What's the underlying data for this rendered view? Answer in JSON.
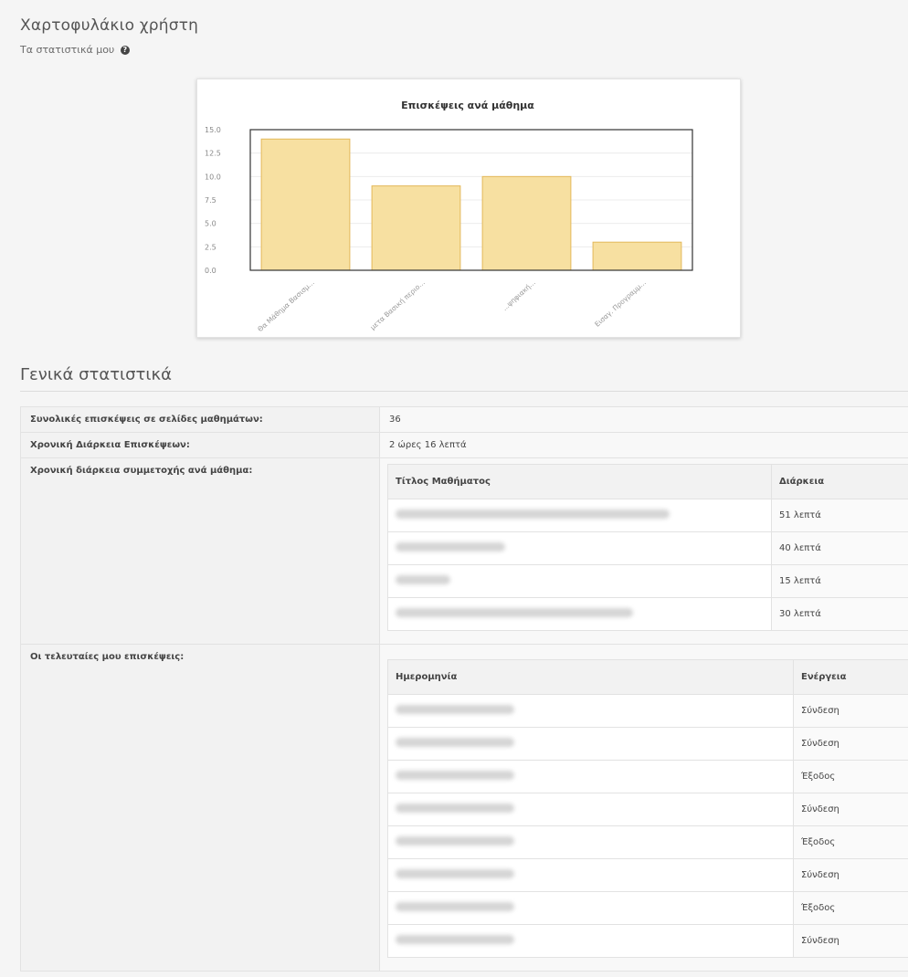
{
  "header": {
    "title": "Χαρτοφυλάκιο χρήστη",
    "subtitle": "Τα στατιστικά μου",
    "help_icon": "question-circle-icon"
  },
  "chart_data": {
    "type": "bar",
    "title": "Επισκέψεις ανά μάθημα",
    "xlabel": "",
    "ylabel": "",
    "categories": [
      "Θα Μάθημα Βασισμ...",
      "μετα Βασική περιο...",
      "...ψηφιακή...",
      "Εισαγ. Προγραμμ..."
    ],
    "values": [
      14,
      9,
      10,
      3
    ],
    "ylim": [
      0,
      15
    ],
    "yticks": [
      "15.0",
      "12.5",
      "10.0",
      "7.5",
      "5.0",
      "2.5",
      "0.0"
    ],
    "bar_color": "#f7e0a1",
    "bar_stroke": "#e3b85a",
    "grid": true
  },
  "general_stats": {
    "title": "Γενικά στατιστικά",
    "rows": [
      {
        "label": "Συνολικές επισκέψεις σε σελίδες μαθημάτων:",
        "value": "36"
      },
      {
        "label": "Χρονική Διάρκεια Επισκέψεων:",
        "value": "2 ώρες 16 λεπτά"
      }
    ],
    "course_duration": {
      "label": "Χρονική διάρκεια συμμετοχής ανά μάθημα:",
      "headers": [
        "Τίτλος Μαθήματος",
        "Διάρκεια"
      ],
      "rows": [
        {
          "duration": "51 λεπτά"
        },
        {
          "duration": "40 λεπτά"
        },
        {
          "duration": "15 λεπτά"
        },
        {
          "duration": "30 λεπτά"
        }
      ]
    },
    "recent_visits": {
      "label": "Οι τελευταίες μου επισκέψεις:",
      "headers": [
        "Ημερομηνία",
        "Ενέργεια"
      ],
      "rows": [
        {
          "action": "Σύνδεση",
          "type": "login"
        },
        {
          "action": "Σύνδεση",
          "type": "login"
        },
        {
          "action": "Έξοδος",
          "type": "logout"
        },
        {
          "action": "Σύνδεση",
          "type": "login"
        },
        {
          "action": "Έξοδος",
          "type": "logout"
        },
        {
          "action": "Σύνδεση",
          "type": "login"
        },
        {
          "action": "Έξοδος",
          "type": "logout"
        },
        {
          "action": "Σύνδεση",
          "type": "login"
        }
      ]
    }
  },
  "colors": {
    "login": "#3a9a26",
    "logout": "#d9303a"
  }
}
